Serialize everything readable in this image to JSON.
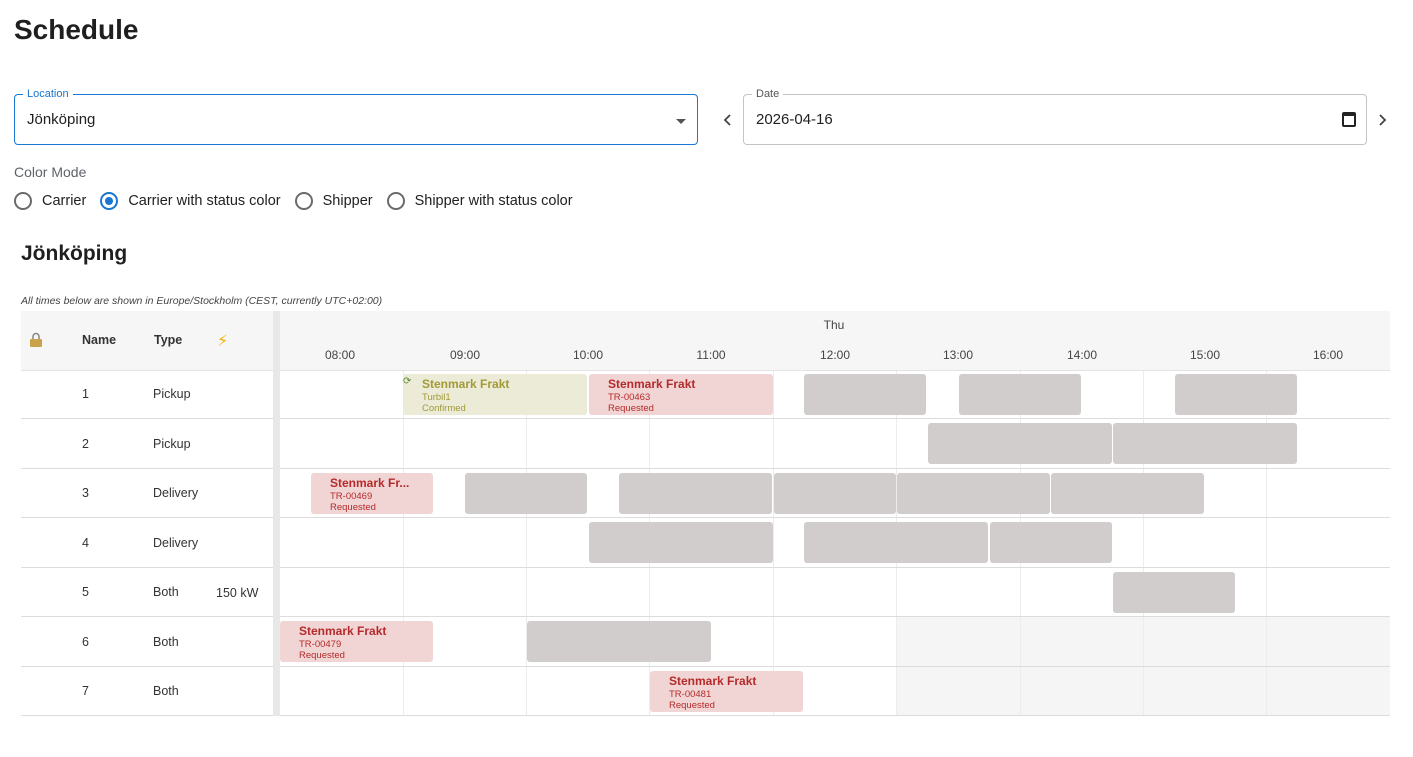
{
  "page": {
    "title": "Schedule"
  },
  "filters": {
    "location": {
      "label": "Location",
      "value": "Jönköping"
    },
    "date": {
      "label": "Date",
      "value": "2026-04-16"
    }
  },
  "color_mode": {
    "label": "Color Mode",
    "options": [
      {
        "label": "Carrier",
        "checked": false
      },
      {
        "label": "Carrier with status color",
        "checked": true
      },
      {
        "label": "Shipper",
        "checked": false
      },
      {
        "label": "Shipper with status color",
        "checked": false
      }
    ]
  },
  "schedule": {
    "title": "Jönköping",
    "timezone_note": "All times below are shown in Europe/Stockholm (CEST, currently UTC+02:00)",
    "columns": {
      "name": "Name",
      "type": "Type"
    },
    "day": "Thu",
    "hours": [
      "08:00",
      "09:00",
      "10:00",
      "11:00",
      "12:00",
      "13:00",
      "14:00",
      "15:00",
      "16:00"
    ],
    "rows": [
      {
        "name": "1",
        "type": "Pickup",
        "power": ""
      },
      {
        "name": "2",
        "type": "Pickup",
        "power": ""
      },
      {
        "name": "3",
        "type": "Delivery",
        "power": ""
      },
      {
        "name": "4",
        "type": "Delivery",
        "power": ""
      },
      {
        "name": "5",
        "type": "Both",
        "power": "150 kW"
      },
      {
        "name": "6",
        "type": "Both",
        "power": ""
      },
      {
        "name": "7",
        "type": "Both",
        "power": ""
      }
    ],
    "bookings": {
      "b1": {
        "carrier": "Stenmark Frakt",
        "ref": "Turbil1",
        "status": "Confirmed"
      },
      "b2": {
        "carrier": "Stenmark Frakt",
        "ref": "TR-00463",
        "status": "Requested"
      },
      "b3": {
        "carrier": "Stenmark Fr...",
        "ref": "TR-00469",
        "status": "Requested"
      },
      "b4": {
        "carrier": "Stenmark Frakt",
        "ref": "TR-00479",
        "status": "Requested"
      },
      "b5": {
        "carrier": "Stenmark Frakt",
        "ref": "TR-00481",
        "status": "Requested"
      }
    }
  },
  "colors": {
    "accent": "#1976d2",
    "requested_bg": "#f1d5d5",
    "requested_text": "#b52a2a",
    "confirmed_bg": "#ebebd7",
    "confirmed_text": "#a29a36",
    "unavailable": "#d2cdcd"
  },
  "icons": {
    "location_dropdown": "chevron-down-icon",
    "date_prev": "chevron-left-icon",
    "date_next": "chevron-right-icon",
    "date_picker": "calendar-icon",
    "lock_column": "lock-icon",
    "power_column": "bolt-icon",
    "recurring": "sync-icon"
  }
}
